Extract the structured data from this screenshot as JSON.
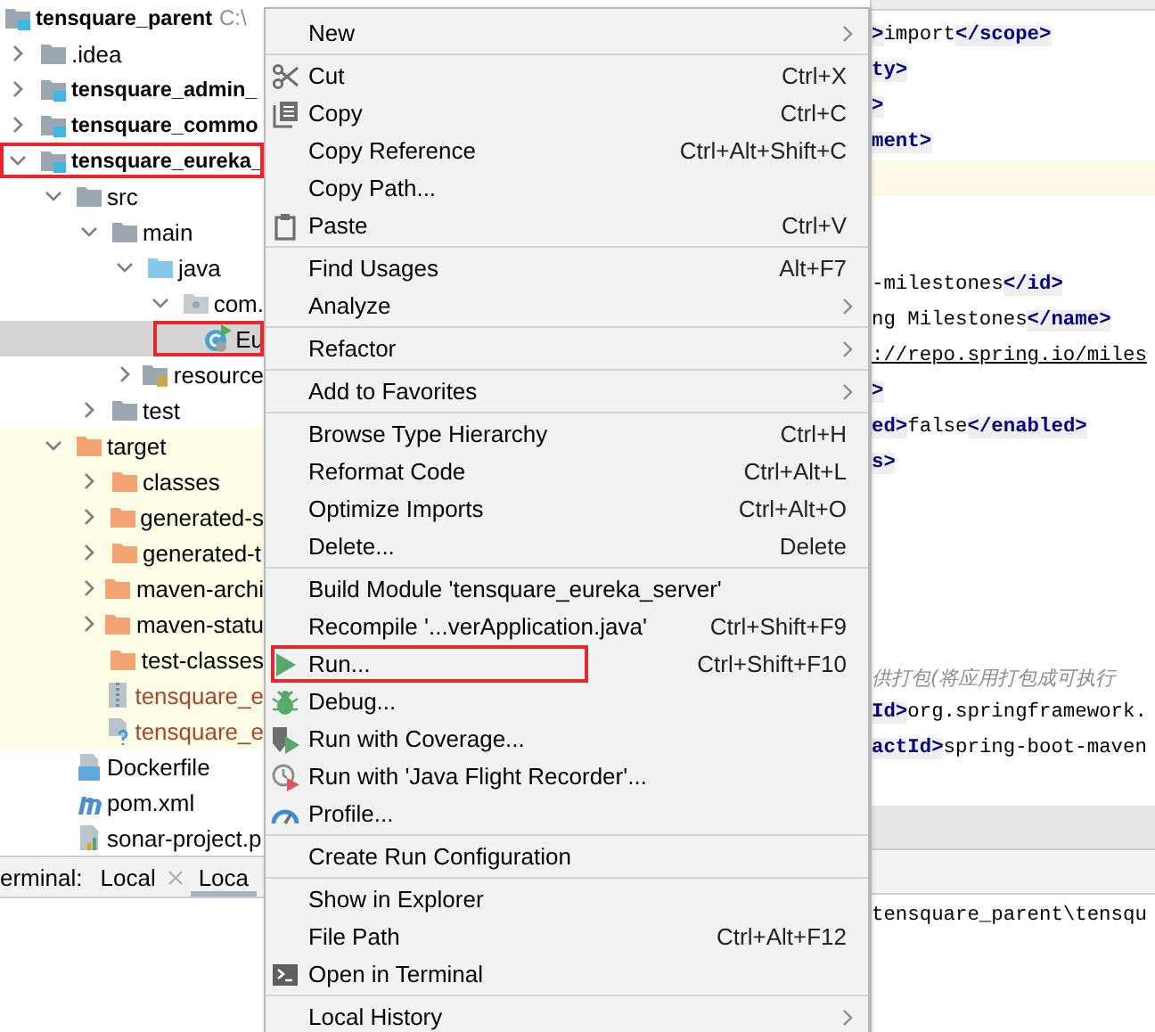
{
  "project_tree": {
    "items": [
      {
        "label": "tensquare_parent",
        "path": "C:\\",
        "kind": "module",
        "bold": true,
        "selected": false,
        "children": [
          {
            "label": ".idea",
            "kind": "folder",
            "expanded": false,
            "selected": false
          },
          {
            "label": "tensquare_admin_",
            "kind": "module",
            "bold": true,
            "expanded": false,
            "selected": false
          },
          {
            "label": "tensquare_commo",
            "kind": "module",
            "bold": true,
            "expanded": false,
            "selected": false
          },
          {
            "label": "tensquare_eureka_",
            "kind": "module",
            "bold": true,
            "expanded": true,
            "selected": false,
            "highlighted": true,
            "children": [
              {
                "label": "src",
                "kind": "folder",
                "expanded": true,
                "selected": false,
                "children": [
                  {
                    "label": "main",
                    "kind": "folder",
                    "expanded": true,
                    "selected": false,
                    "children": [
                      {
                        "label": "java",
                        "kind": "source",
                        "expanded": true,
                        "selected": false,
                        "children": [
                          {
                            "label": "com.",
                            "kind": "package",
                            "expanded": true,
                            "selected": false,
                            "children": [
                              {
                                "label": "Eu",
                                "kind": "class",
                                "selected": true,
                                "highlighted": true
                              }
                            ]
                          }
                        ]
                      },
                      {
                        "label": "resource",
                        "kind": "resources",
                        "expanded": false,
                        "selected": false
                      }
                    ]
                  },
                  {
                    "label": "test",
                    "kind": "folder",
                    "expanded": false,
                    "selected": false
                  }
                ]
              },
              {
                "label": "target",
                "kind": "excluded",
                "expanded": true,
                "excluded": true,
                "selected": false,
                "children": [
                  {
                    "label": "classes",
                    "kind": "excluded",
                    "expanded": false,
                    "selected": false
                  },
                  {
                    "label": "generated-s",
                    "kind": "excluded",
                    "expanded": false,
                    "selected": false
                  },
                  {
                    "label": "generated-t",
                    "kind": "excluded",
                    "expanded": false,
                    "selected": false
                  },
                  {
                    "label": "maven-archi",
                    "kind": "excluded",
                    "expanded": false,
                    "selected": false
                  },
                  {
                    "label": "maven-statu",
                    "kind": "excluded",
                    "expanded": false,
                    "selected": false
                  },
                  {
                    "label": "test-classes",
                    "kind": "excluded",
                    "selected": false
                  },
                  {
                    "label": "tensquare_e",
                    "kind": "jar",
                    "ignored": true,
                    "selected": false
                  },
                  {
                    "label": "tensquare_e",
                    "kind": "unknown",
                    "ignored": true,
                    "selected": false
                  }
                ]
              },
              {
                "label": "Dockerfile",
                "kind": "docker",
                "selected": false
              },
              {
                "label": "pom.xml",
                "kind": "maven",
                "selected": false
              },
              {
                "label": "sonar-project.p",
                "kind": "properties",
                "selected": false
              }
            ]
          }
        ]
      }
    ]
  },
  "context_menu": {
    "items": [
      {
        "kind": "plain",
        "label": "New",
        "submenu": true
      },
      {
        "kind": "separator"
      },
      {
        "kind": "cut",
        "label": "Cut",
        "shortcut": "Ctrl+X"
      },
      {
        "kind": "copy",
        "label": "Copy",
        "shortcut": "Ctrl+C"
      },
      {
        "kind": "plain",
        "label": "Copy Reference",
        "shortcut": "Ctrl+Alt+Shift+C"
      },
      {
        "kind": "plain",
        "label": "Copy Path..."
      },
      {
        "kind": "paste",
        "label": "Paste",
        "shortcut": "Ctrl+V"
      },
      {
        "kind": "separator"
      },
      {
        "kind": "plain",
        "label": "Find Usages",
        "shortcut": "Alt+F7"
      },
      {
        "kind": "plain",
        "label": "Analyze",
        "submenu": true
      },
      {
        "kind": "separator"
      },
      {
        "kind": "plain",
        "label": "Refactor",
        "submenu": true
      },
      {
        "kind": "separator"
      },
      {
        "kind": "plain",
        "label": "Add to Favorites",
        "submenu": true
      },
      {
        "kind": "separator"
      },
      {
        "kind": "plain",
        "label": "Browse Type Hierarchy",
        "shortcut": "Ctrl+H"
      },
      {
        "kind": "plain",
        "label": "Reformat Code",
        "shortcut": "Ctrl+Alt+L"
      },
      {
        "kind": "plain",
        "label": "Optimize Imports",
        "shortcut": "Ctrl+Alt+O"
      },
      {
        "kind": "plain",
        "label": "Delete...",
        "shortcut": "Delete"
      },
      {
        "kind": "separator"
      },
      {
        "kind": "plain",
        "label": "Build Module 'tensquare_eureka_server'"
      },
      {
        "kind": "plain",
        "label": "Recompile '...verApplication.java'",
        "shortcut": "Ctrl+Shift+F9"
      },
      {
        "kind": "run",
        "label": "Run...",
        "shortcut": "Ctrl+Shift+F10",
        "highlighted": true
      },
      {
        "kind": "debug",
        "label": "Debug..."
      },
      {
        "kind": "coverage",
        "label": "Run with Coverage..."
      },
      {
        "kind": "recorder",
        "label": "Run with 'Java Flight Recorder'..."
      },
      {
        "kind": "profile",
        "label": "Profile..."
      },
      {
        "kind": "separator"
      },
      {
        "kind": "plain",
        "label": "Create Run Configuration"
      },
      {
        "kind": "separator"
      },
      {
        "kind": "plain",
        "label": "Show in Explorer"
      },
      {
        "kind": "plain",
        "label": "File Path",
        "shortcut": "Ctrl+Alt+F12"
      },
      {
        "kind": "terminal",
        "label": "Open in Terminal"
      },
      {
        "kind": "separator"
      },
      {
        "kind": "plain",
        "label": "Local History",
        "submenu": true
      }
    ]
  },
  "editor": {
    "lines": [
      {
        "kind": "code",
        "segments": [
          {
            "kind": "tag",
            "text": ">"
          },
          {
            "kind": "text",
            "text": "import"
          },
          {
            "kind": "tag",
            "text": "</scope>"
          }
        ]
      },
      {
        "kind": "code",
        "segments": [
          {
            "kind": "tag",
            "text": "ty>"
          }
        ]
      },
      {
        "kind": "code",
        "segments": [
          {
            "kind": "tag",
            "text": ">"
          }
        ]
      },
      {
        "kind": "code",
        "segments": [
          {
            "kind": "tag",
            "text": "ment>"
          }
        ]
      },
      {
        "kind": "blank",
        "current": true
      },
      {
        "kind": "blank",
        "current": false
      },
      {
        "kind": "blank",
        "current": false
      },
      {
        "kind": "code",
        "segments": [
          {
            "kind": "text",
            "text": "-milestones"
          },
          {
            "kind": "tag",
            "text": "</id>"
          }
        ]
      },
      {
        "kind": "code",
        "segments": [
          {
            "kind": "text",
            "text": "ng Milestones"
          },
          {
            "kind": "tag",
            "text": "</name>"
          }
        ]
      },
      {
        "kind": "code",
        "segments": [
          {
            "kind": "link",
            "text": "://repo.spring.io/miles"
          }
        ]
      },
      {
        "kind": "code",
        "segments": [
          {
            "kind": "tag",
            "text": ">"
          }
        ]
      },
      {
        "kind": "code",
        "segments": [
          {
            "kind": "tag",
            "text": "ed>"
          },
          {
            "kind": "text",
            "text": "false"
          },
          {
            "kind": "tag",
            "text": "</enabled>"
          }
        ]
      },
      {
        "kind": "code",
        "segments": [
          {
            "kind": "tag",
            "text": "s>"
          }
        ]
      },
      {
        "kind": "blank",
        "current": false
      },
      {
        "kind": "blank",
        "current": false
      },
      {
        "kind": "blank",
        "current": false
      },
      {
        "kind": "blank",
        "current": false
      },
      {
        "kind": "blank",
        "current": false
      },
      {
        "kind": "code",
        "segments": [
          {
            "kind": "comment",
            "text": "供打包(将应用打包成可执行"
          }
        ]
      },
      {
        "kind": "code",
        "segments": [
          {
            "kind": "tag",
            "text": "Id>"
          },
          {
            "kind": "text",
            "text": "org.springframework."
          }
        ]
      },
      {
        "kind": "code",
        "segments": [
          {
            "kind": "tag",
            "text": "actId>"
          },
          {
            "kind": "text",
            "text": "spring-boot-maven"
          }
        ]
      }
    ]
  },
  "terminal": {
    "title": "erminal:",
    "tabs": [
      {
        "label": "Local",
        "closable": true,
        "selected": false
      },
      {
        "label": "Loca",
        "closable": false,
        "selected": true
      }
    ],
    "output": "tensquare_parent\\tensqu"
  }
}
